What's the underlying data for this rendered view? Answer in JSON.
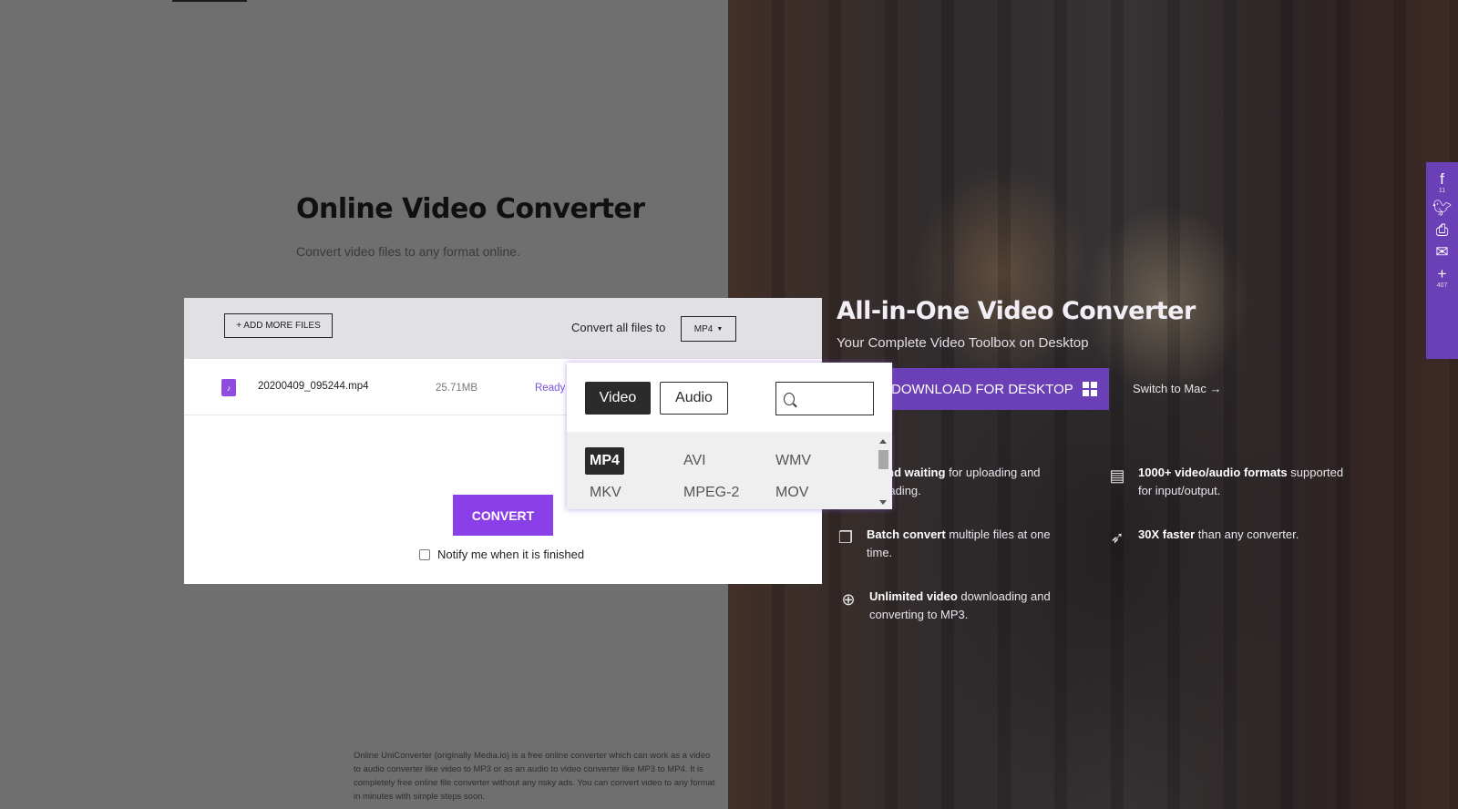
{
  "page": {
    "title": "Online Video Converter",
    "subtitle": "Convert video files to any format online.",
    "footer": "Online UniConverter (originally Media.io) is a free online converter which can work as a video to audio converter like video to MP3 or as an audio to video converter like MP3 to MP4. It is completely free online file converter without any risky ads. You can convert video to any format in minutes with simple steps soon."
  },
  "panel": {
    "add_more_label": "+ ADD MORE FILES",
    "convert_all_label": "Convert all files to",
    "selected_format": "MP4",
    "file": {
      "name": "20200409_095244.mp4",
      "size": "25.71MB",
      "status": "Ready"
    },
    "convert_label": "CONVERT",
    "notify_label": "Notify me when it is finished"
  },
  "dropdown": {
    "tabs": [
      "Video",
      "Audio"
    ],
    "search_placeholder": "",
    "formats": [
      "MP4",
      "AVI",
      "WMV",
      "MKV",
      "MPEG-2",
      "MOV"
    ],
    "selected": "MP4"
  },
  "hero": {
    "title": "All-in-One Video Converter",
    "subtitle": "Your Complete Video Toolbox on Desktop",
    "download_label": "DOWNLOAD FOR DESKTOP",
    "switch_label": "Switch to Mac →",
    "features": [
      {
        "bold": "cond waiting",
        "rest": " for uploading and nloading.",
        "icon": "clock-icon"
      },
      {
        "bold": "1000+ video/audio formats",
        "rest": " supported for input/output.",
        "icon": "film-icon"
      },
      {
        "bold": "Batch convert",
        "rest": " multiple files at one time.",
        "icon": "files-icon"
      },
      {
        "bold": "30X faster",
        "rest": " than any converter.",
        "icon": "rocket-icon"
      },
      {
        "bold": "Unlimited video",
        "rest": " downloading and converting to MP3.",
        "icon": "download-icon"
      }
    ]
  },
  "social": {
    "facebook_count": "11",
    "share_count": "407"
  },
  "colors": {
    "accent": "#8b3fe8",
    "brand": "#6b3fb6"
  }
}
